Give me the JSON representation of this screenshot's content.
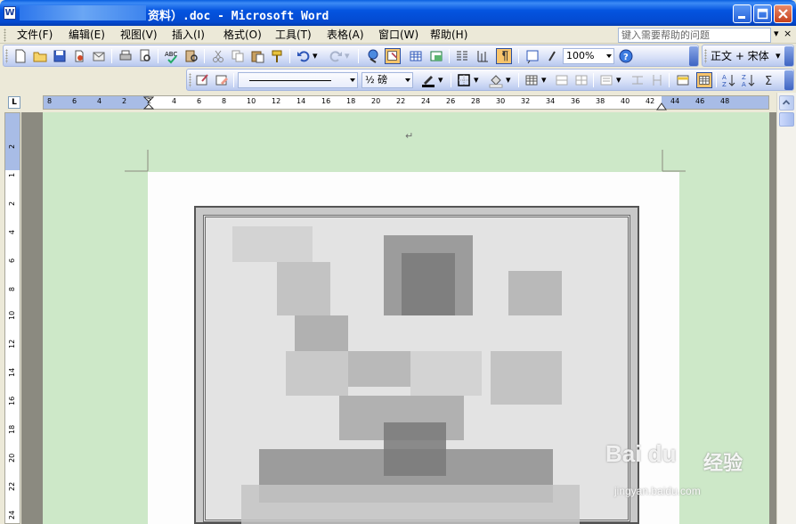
{
  "window": {
    "title": "资料）.doc - Microsoft Word",
    "icon": "word-doc-icon"
  },
  "menu": {
    "items": [
      {
        "label": "文件(F)",
        "icon": null
      },
      {
        "label": "编辑(E)",
        "icon": null
      },
      {
        "label": "视图(V)",
        "icon": null
      },
      {
        "label": "插入(I)",
        "icon": null
      },
      {
        "label": "格式(O)",
        "icon": null
      },
      {
        "label": "工具(T)",
        "icon": null
      },
      {
        "label": "表格(A)",
        "icon": null
      },
      {
        "label": "窗口(W)",
        "icon": null
      },
      {
        "label": "帮助(H)",
        "icon": null
      }
    ],
    "help_placeholder": "键入需要帮助的问题"
  },
  "toolbar_standard": {
    "zoom": "100%",
    "style": "正文 + 宋体"
  },
  "toolbar_drawing": {
    "line_weight": "½ 磅"
  },
  "ruler": {
    "h_numbers": [
      "8",
      "6",
      "4",
      "2",
      "2",
      "4",
      "6",
      "8",
      "10",
      "12",
      "14",
      "16",
      "18",
      "20",
      "22",
      "24",
      "26",
      "28",
      "30",
      "32",
      "34",
      "36",
      "38",
      "40",
      "42",
      "44",
      "46",
      "48"
    ],
    "v_numbers": [
      "2",
      "1",
      "2",
      "4",
      "6",
      "8",
      "10",
      "12",
      "14",
      "16",
      "18",
      "20",
      "22",
      "24"
    ],
    "tab_selector": "L"
  },
  "document": {
    "paragraph_mark": "↵"
  },
  "watermark": {
    "brand": "Bai du",
    "cn": "经验",
    "url": "jingyan.baidu.com"
  },
  "colors": {
    "title_bar": "#0555e0",
    "page_background": "#cde8c8",
    "toolbar": "#d6dff7",
    "active_button": "#f8c46c"
  }
}
